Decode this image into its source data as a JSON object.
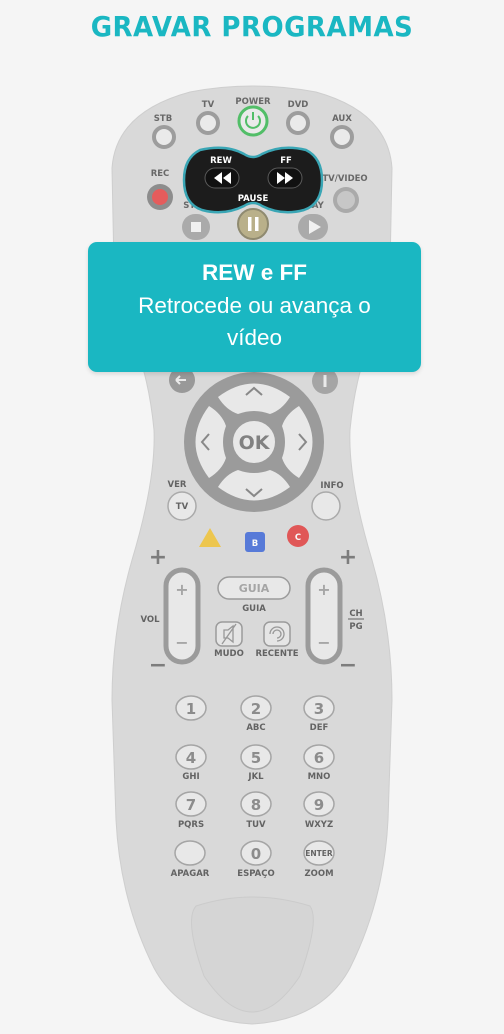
{
  "page": {
    "title": "GRAVAR PROGRAMAS"
  },
  "remote": {
    "top_labels": {
      "stb": "STB",
      "tv": "TV",
      "power": "POWER",
      "dvd": "DVD",
      "aux": "AUX"
    },
    "transport": {
      "rec": "REC",
      "rew": "REW",
      "ff": "FF",
      "pause": "PAUSE",
      "stop": "STOP",
      "play": "PLAY",
      "tvvideo": "TV/VIDEO"
    },
    "nav": {
      "ok": "OK",
      "ver": "VER",
      "tv": "TV",
      "info": "INFO"
    },
    "color_keys": {
      "b": "B",
      "c": "C"
    },
    "volume": {
      "vol": "VOL",
      "plus": "+",
      "minus": "−",
      "ch": "CH",
      "pg": "PG"
    },
    "center": {
      "guia_button": "GUIA",
      "guia_label": "GUIA",
      "mudo": "MUDO",
      "recente": "RECENTE"
    },
    "keypad": [
      {
        "num": "1",
        "letters": ""
      },
      {
        "num": "2",
        "letters": "ABC"
      },
      {
        "num": "3",
        "letters": "DEF"
      },
      {
        "num": "4",
        "letters": "GHI"
      },
      {
        "num": "5",
        "letters": "JKL"
      },
      {
        "num": "6",
        "letters": "MNO"
      },
      {
        "num": "7",
        "letters": "PQRS"
      },
      {
        "num": "8",
        "letters": "TUV"
      },
      {
        "num": "9",
        "letters": "WXYZ"
      }
    ],
    "bottom_row": {
      "apagar": "APAGAR",
      "zero": "0",
      "espaco": "ESPAÇO",
      "enter": "ENTER",
      "zoom": "ZOOM"
    }
  },
  "callout": {
    "title": "REW e FF",
    "body": "Retrocede ou avança o vídeo"
  },
  "colors": {
    "accent": "#1ab7c2",
    "remote_body": "#d4d4d4",
    "button": "#ececec",
    "highlight": "#1c1c1c",
    "highlight_ring": "#3aa6b5",
    "power": "#2fb34a",
    "rec": "#e23b3b",
    "key_a": "#f2c230",
    "key_b": "#3b66d8",
    "key_c": "#e23b3b"
  }
}
